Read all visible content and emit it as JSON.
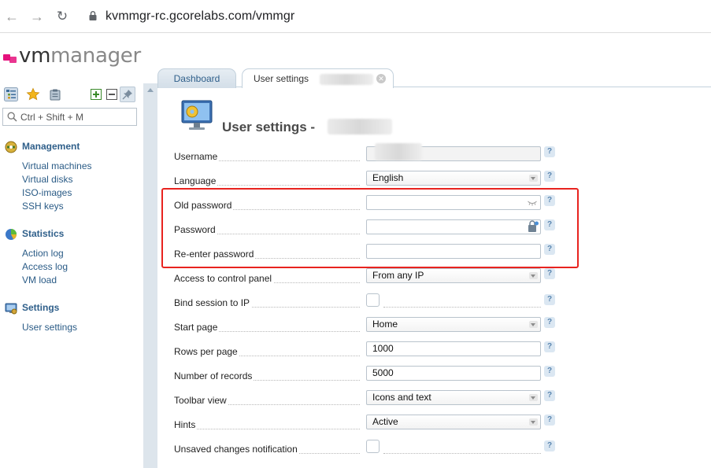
{
  "browser": {
    "url_host": "kvmmgr-rc.gcorelabs.com",
    "url_path": "/vmmgr"
  },
  "logo": {
    "vm": "vm",
    "manager": "manager"
  },
  "sidebar": {
    "search_placeholder": "Ctrl + Shift + M",
    "sections": [
      {
        "title": "Management",
        "icon": "management-icon",
        "items": [
          "Virtual machines",
          "Virtual disks",
          "ISO-images",
          "SSH keys"
        ]
      },
      {
        "title": "Statistics",
        "icon": "pie-chart-icon",
        "items": [
          "Action log",
          "Access log",
          "VM load"
        ]
      },
      {
        "title": "Settings",
        "icon": "settings-icon",
        "items": [
          "User settings"
        ]
      }
    ]
  },
  "tabs": [
    {
      "label": "Dashboard",
      "active": false
    },
    {
      "label": "User settings",
      "active": true
    }
  ],
  "page": {
    "title": "User settings -"
  },
  "form": {
    "rows": [
      {
        "label": "Username",
        "type": "readonly",
        "value": ""
      },
      {
        "label": "Language",
        "type": "select",
        "value": "English"
      },
      {
        "label": "Old password",
        "type": "password",
        "value": ""
      },
      {
        "label": "Password",
        "type": "password-gen",
        "value": ""
      },
      {
        "label": "Re-enter password",
        "type": "text",
        "value": ""
      },
      {
        "label": "Access to control panel",
        "type": "select",
        "value": "From any IP"
      },
      {
        "label": "Bind session to IP",
        "type": "checkbox",
        "value": ""
      },
      {
        "label": "Start page",
        "type": "select",
        "value": "Home"
      },
      {
        "label": "Rows per page",
        "type": "text",
        "value": "1000"
      },
      {
        "label": "Number of records",
        "type": "text",
        "value": "5000"
      },
      {
        "label": "Toolbar view",
        "type": "select",
        "value": "Icons and text"
      },
      {
        "label": "Hints",
        "type": "select",
        "value": "Active"
      },
      {
        "label": "Unsaved changes notification",
        "type": "checkbox",
        "value": ""
      }
    ],
    "help_label": "?"
  },
  "colors": {
    "accent": "#2f5f8a",
    "brand": "#e5127d",
    "highlight": "#e8231f"
  }
}
